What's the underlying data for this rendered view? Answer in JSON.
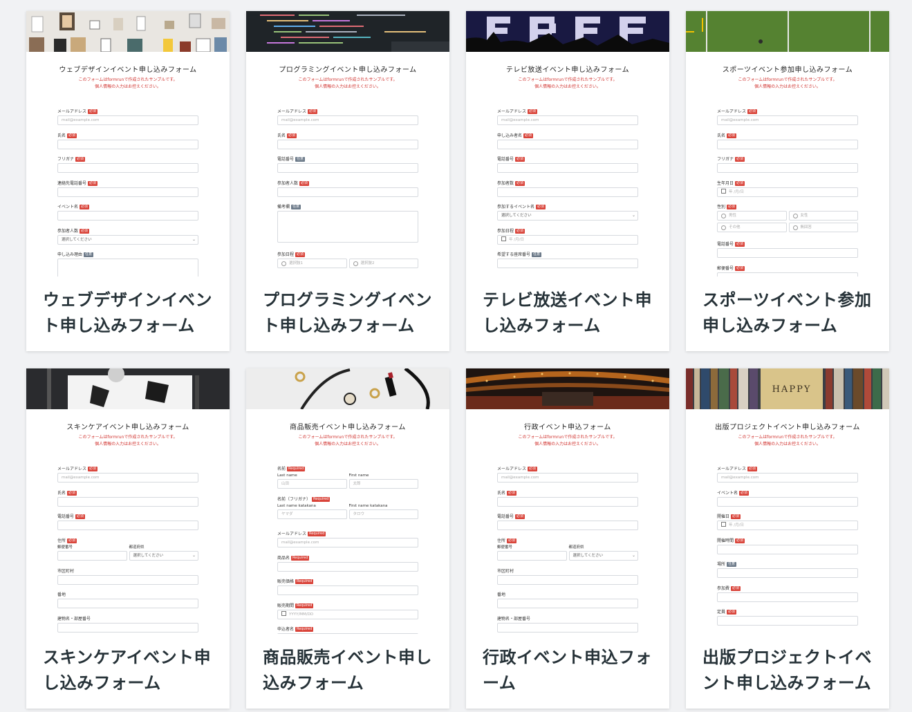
{
  "sample_note_line1": "このフォームはformrunで作成されたサンプルです。",
  "sample_note_line2": "個人情報の入力はお控えください。",
  "cards": [
    {
      "title": "ウェブデザインイベント申し込みフォーム",
      "form_title": "ウェブデザインイベント申し込みフォーム",
      "thumb_icon": "gallery-wall-photo",
      "fields": [
        {
          "label": "メールアドレス",
          "badge": "必須",
          "placeholder": "mail@example.com"
        },
        {
          "label": "氏名",
          "badge": "必須",
          "placeholder": ""
        },
        {
          "label": "フリガナ",
          "badge": "必須",
          "placeholder": ""
        },
        {
          "label": "連絡先電話番号",
          "badge": "必須",
          "placeholder": ""
        },
        {
          "label": "イベント名",
          "badge": "必須",
          "placeholder": ""
        },
        {
          "label": "参加者人数",
          "badge": "必須",
          "placeholder": "選択してください"
        },
        {
          "label": "申し込み理由",
          "badge": "任意",
          "placeholder": ""
        }
      ]
    },
    {
      "title": "プログラミングイベント申し込みフォーム",
      "form_title": "プログラミングイベント申し込みフォーム",
      "thumb_icon": "code-screen-photo",
      "fields": [
        {
          "label": "メールアドレス",
          "badge": "必須",
          "placeholder": "mail@example.com"
        },
        {
          "label": "氏名",
          "badge": "必須",
          "placeholder": ""
        },
        {
          "label": "電話番号",
          "badge": "任意",
          "placeholder": ""
        },
        {
          "label": "参加者人数",
          "badge": "必須",
          "placeholder": ""
        },
        {
          "label": "備考欄",
          "badge": "任意",
          "placeholder": ""
        },
        {
          "label": "参加日程",
          "badge": "必須",
          "options": [
            "選択肢1",
            "選択肢2"
          ]
        }
      ]
    },
    {
      "title": "テレビ放送イベント申し込みフォーム",
      "form_title": "テレビ放送イベント申し込みフォーム",
      "thumb_icon": "free-lights-photo",
      "fields": [
        {
          "label": "メールアドレス",
          "badge": "必須",
          "placeholder": "mail@example.com"
        },
        {
          "label": "申し込み者名",
          "badge": "必須",
          "placeholder": ""
        },
        {
          "label": "電話番号",
          "badge": "必須",
          "placeholder": ""
        },
        {
          "label": "参加者数",
          "badge": "必須",
          "placeholder": ""
        },
        {
          "label": "参加するイベント名",
          "badge": "必須",
          "placeholder": "選択してください"
        },
        {
          "label": "参加日程",
          "badge": "必須",
          "placeholder": "年 /月/日"
        },
        {
          "label": "希望する座席番号",
          "badge": "任意",
          "placeholder": ""
        }
      ]
    },
    {
      "title": "スポーツイベント参加申し込みフォーム",
      "form_title": "スポーツイベント参加申し込みフォーム",
      "thumb_icon": "football-field-photo",
      "fields": [
        {
          "label": "メールアドレス",
          "badge": "必須",
          "placeholder": "mail@example.com"
        },
        {
          "label": "氏名",
          "badge": "必須",
          "placeholder": ""
        },
        {
          "label": "フリガナ",
          "badge": "必須",
          "placeholder": ""
        },
        {
          "label": "生年月日",
          "badge": "必須",
          "placeholder": "年 /月/日"
        },
        {
          "label": "性別",
          "badge": "必須",
          "options": [
            "男性",
            "女性",
            "その他",
            "無回答"
          ]
        },
        {
          "label": "電話番号",
          "badge": "必須",
          "placeholder": ""
        },
        {
          "label": "郵便番号",
          "badge": "必須",
          "placeholder": ""
        }
      ]
    },
    {
      "title": "スキンケアイベント申し込みフォーム",
      "form_title": "スキンケアイベント申し込みフォーム",
      "thumb_icon": "photo-studio-photo",
      "fields": [
        {
          "label": "メールアドレス",
          "badge": "必須",
          "placeholder": "mail@example.com"
        },
        {
          "label": "氏名",
          "badge": "必須",
          "placeholder": ""
        },
        {
          "label": "電話番号",
          "badge": "必須",
          "placeholder": ""
        },
        {
          "label": "住所",
          "badge": "必須",
          "sub": [
            "郵便番号",
            "都道府県"
          ],
          "sub_placeholder": "選択してください"
        },
        {
          "label": "市区町村",
          "badge": "",
          "placeholder": ""
        },
        {
          "label": "番地",
          "badge": "",
          "placeholder": ""
        },
        {
          "label": "建物名・部屋番号",
          "badge": "",
          "placeholder": ""
        }
      ]
    },
    {
      "title": "商品販売イベント申し込みフォーム",
      "form_title": "商品販売イベント申し込みフォーム",
      "thumb_icon": "accessories-photo",
      "fields": [
        {
          "label": "名前",
          "badge": "Required",
          "sub": [
            "Last name",
            "First name"
          ],
          "sub_values": [
            "山田",
            "太郎"
          ]
        },
        {
          "label": "名前（フリガナ）",
          "badge": "Required",
          "sub": [
            "Last name katakana",
            "First name katakana"
          ],
          "sub_values": [
            "ヤマダ",
            "タロウ"
          ]
        },
        {
          "label": "メールアドレス",
          "badge": "Required",
          "placeholder": "mail@example.com"
        },
        {
          "label": "商品名",
          "badge": "Required",
          "placeholder": ""
        },
        {
          "label": "販売価格",
          "badge": "Required",
          "placeholder": ""
        },
        {
          "label": "販売期間",
          "badge": "Required",
          "placeholder": "YYYY/MM/DD"
        },
        {
          "label": "申込者名",
          "badge": "Required",
          "placeholder": ""
        }
      ]
    },
    {
      "title": "行政イベント申込フォーム",
      "form_title": "行政イベント申込フォーム",
      "thumb_icon": "concert-hall-photo",
      "fields": [
        {
          "label": "メールアドレス",
          "badge": "必須",
          "placeholder": "mail@example.com"
        },
        {
          "label": "氏名",
          "badge": "必須",
          "placeholder": ""
        },
        {
          "label": "電話番号",
          "badge": "必須",
          "placeholder": ""
        },
        {
          "label": "住所",
          "badge": "必須",
          "sub": [
            "郵便番号",
            "都道府県"
          ],
          "sub_placeholder": "選択してください"
        },
        {
          "label": "市区町村",
          "badge": "",
          "placeholder": ""
        },
        {
          "label": "番地",
          "badge": "",
          "placeholder": ""
        },
        {
          "label": "建物名・部屋番号",
          "badge": "",
          "placeholder": ""
        }
      ]
    },
    {
      "title": "出版プロジェクトイベント申し込みフォーム",
      "form_title": "出版プロジェクトイベント申し込みフォーム",
      "thumb_icon": "happy-book-photo",
      "thumb_text": "HAPPY",
      "fields": [
        {
          "label": "メールアドレス",
          "badge": "必須",
          "placeholder": "mail@example.com"
        },
        {
          "label": "イベント名",
          "badge": "必須",
          "placeholder": ""
        },
        {
          "label": "開催日",
          "badge": "必須",
          "placeholder": "年 /月/日"
        },
        {
          "label": "開催時間",
          "badge": "必須",
          "placeholder": ""
        },
        {
          "label": "場所",
          "badge": "任意",
          "placeholder": ""
        },
        {
          "label": "参加費",
          "badge": "必須",
          "placeholder": ""
        },
        {
          "label": "定員",
          "badge": "必須",
          "placeholder": ""
        }
      ]
    }
  ]
}
